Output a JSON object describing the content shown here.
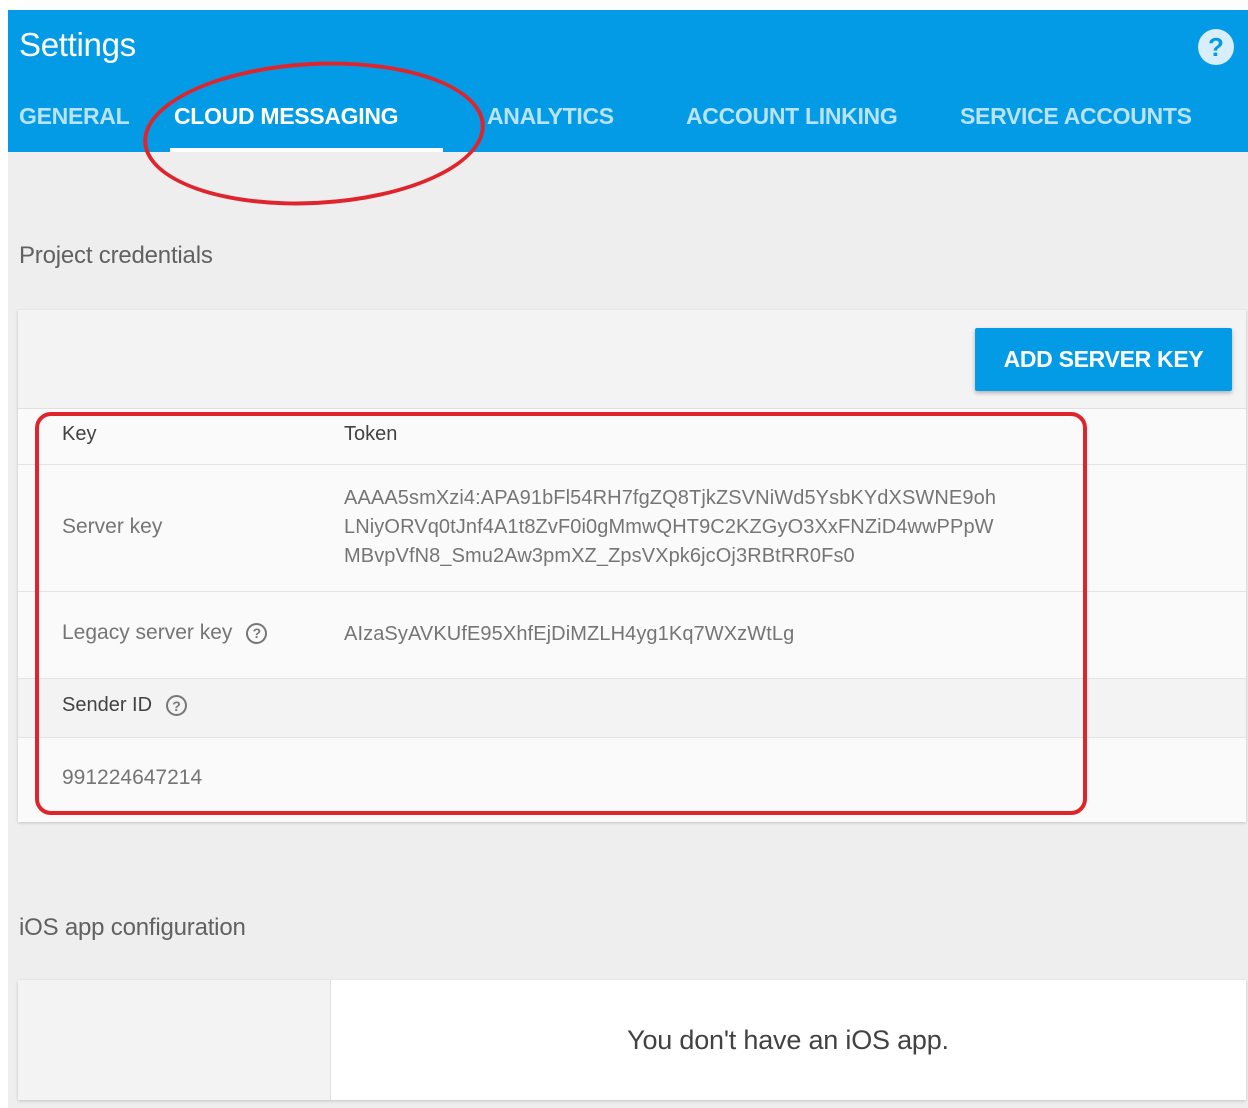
{
  "header": {
    "title": "Settings",
    "help_label": "?",
    "tabs": [
      {
        "label": "GENERAL"
      },
      {
        "label": "CLOUD MESSAGING"
      },
      {
        "label": "ANALYTICS"
      },
      {
        "label": "ACCOUNT LINKING"
      },
      {
        "label": "SERVICE ACCOUNTS"
      }
    ],
    "active_tab": "CLOUD MESSAGING"
  },
  "credentials": {
    "section_title": "Project credentials",
    "add_button_label": "ADD SERVER KEY",
    "columns": [
      "Key",
      "Token"
    ],
    "server_key": {
      "label": "Server key",
      "token_lines": [
        "AAAA5smXzi4:APA91bFl54RH7fgZQ8TjkZSVNiWd5YsbKYdXSWNE9oh",
        "LNiyORVq0tJnf4A1t8ZvF0i0gMmwQHT9C2KZGyO3XxFNZiD4wwPPpW",
        "MBvpVfN8_Smu2Aw3pmXZ_ZpsVXpk6jcOj3RBtRR0Fs0"
      ]
    },
    "legacy_server_key": {
      "label": "Legacy server key",
      "token": "AIzaSyAVKUfE95XhfEjDiMZLH4yg1Kq7WXzWtLg"
    },
    "sender_id": {
      "label": "Sender ID",
      "value": "991224647214"
    }
  },
  "ios": {
    "section_title": "iOS app configuration",
    "empty_message": "You don't have an iOS app."
  },
  "colors": {
    "header_blue": "#039be5",
    "annotation_red": "#e0242c",
    "page_bg": "#eeeeee"
  }
}
